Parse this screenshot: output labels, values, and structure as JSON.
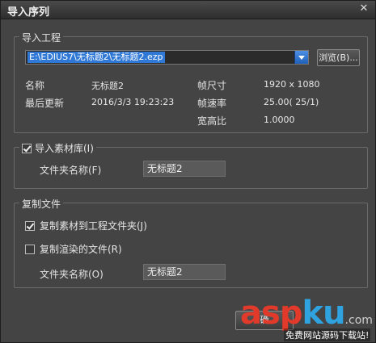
{
  "window": {
    "title": "导入序列",
    "close_glyph": "✕"
  },
  "import_project": {
    "legend": "导入工程",
    "path_value": "E:\\EDIUS7\\无标题2\\无标题2.ezp",
    "browse_label": "浏览(B)...",
    "info": {
      "name_label": "名称",
      "name_value": "无标题2",
      "updated_label": "最后更新",
      "updated_value": "2016/3/3 19:23:23",
      "frame_size_label": "帧尺寸",
      "frame_size_value": "1920 x 1080",
      "frame_rate_label": "帧速率",
      "frame_rate_value": "25.00( 25/1)",
      "aspect_label": "宽高比",
      "aspect_value": "1.0000"
    }
  },
  "import_bin": {
    "checkbox_label": "导入素材库(I)",
    "checked": true,
    "folder_label": "文件夹名称(F)",
    "folder_value": "无标题2"
  },
  "copy_files": {
    "legend": "复制文件",
    "copy_clips_label": "复制素材到工程文件夹(J)",
    "copy_clips_checked": true,
    "copy_rendered_label": "复制渲染的文件(R)",
    "copy_rendered_checked": false,
    "folder_label": "文件夹名称(O)",
    "folder_value": "无标题2"
  },
  "footer": {
    "ok_label": "确"
  },
  "watermark": {
    "brand": "aspku",
    "tld": ".com",
    "tagline": "免费网站源码下载站!",
    "colors": {
      "a": "#e23a2a",
      "s": "#e23a2a",
      "p": "#e23a2a",
      "k": "#2ea3e0",
      "u": "#2ea3e0"
    }
  }
}
